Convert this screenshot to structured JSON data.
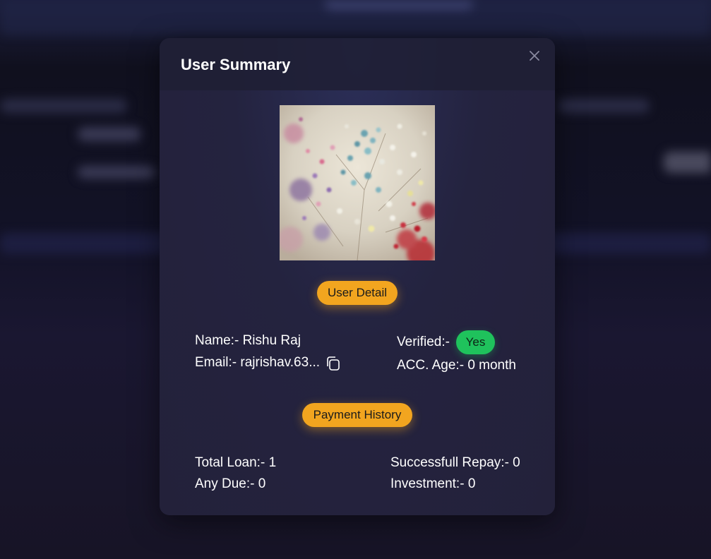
{
  "modal": {
    "title": "User Summary",
    "close_icon": "close-icon"
  },
  "user_detail": {
    "label": "User Detail",
    "name": "Name:- Rishu Raj",
    "email": "Email:- rajrishav.63...",
    "copy_icon": "copy-icon",
    "verified_label": "Verified:-",
    "verified_value": "Yes",
    "account_age": "ACC. Age:- 0 month"
  },
  "payment_history": {
    "label": "Payment History",
    "total_loan": "Total Loan:- 1",
    "any_due": "Any Due:- 0",
    "successful_repay": "Successfull Repay:- 0",
    "investment": "Investment:- 0"
  },
  "colors": {
    "accent": "#f2a51f",
    "verified": "#1fc25c",
    "modal_bg": "#24233f"
  }
}
